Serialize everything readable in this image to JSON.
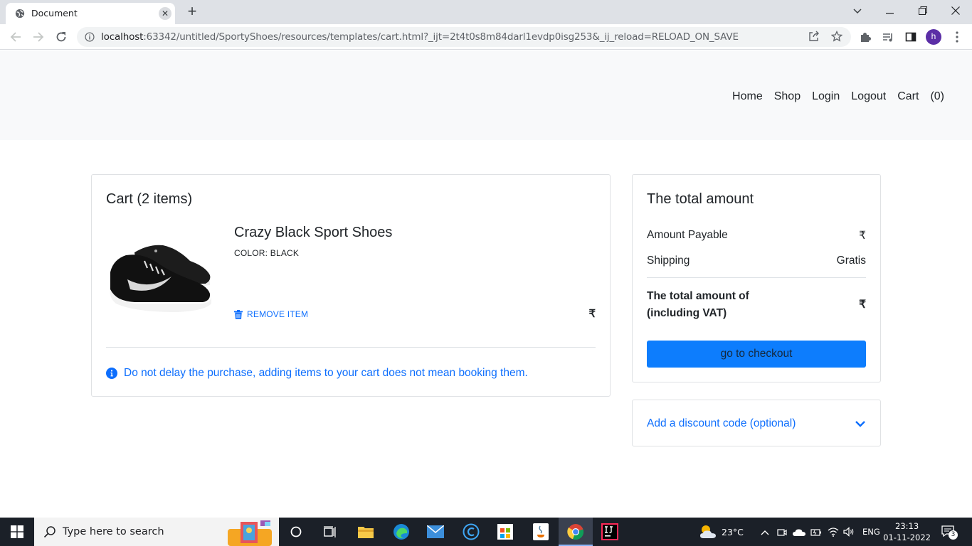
{
  "browser": {
    "tab_title": "Document",
    "tab_close": "✕",
    "new_tab": "+",
    "url_host": "localhost",
    "url_rest": ":63342/untitled/SportyShoes/resources/templates/cart.html?_ijt=2t4t0s8m84darl1evdp0isg253&_ij_reload=RELOAD_ON_SAVE",
    "profile_initial": "h"
  },
  "nav": {
    "links": [
      "Home",
      "Shop",
      "Login",
      "Logout",
      "Cart",
      "(0)"
    ]
  },
  "cart": {
    "title": "Cart (2 items)",
    "item": {
      "name": "Crazy Black Sport Shoes",
      "color": "COLOR: BLACK",
      "remove_label": "REMOVE ITEM",
      "price": "₹"
    },
    "info_message": "Do not delay the purchase, adding items to your cart does not mean booking them."
  },
  "summary": {
    "title": "The total amount",
    "amount_payable_label": "Amount Payable",
    "amount_payable_value": "₹",
    "shipping_label": "Shipping",
    "shipping_value": "Gratis",
    "total_label": "The total amount of (including VAT)",
    "total_value": "₹",
    "checkout_label": "go to checkout"
  },
  "discount": {
    "label": "Add a discount code (optional)"
  },
  "taskbar": {
    "search_placeholder": "Type here to search",
    "weather": "23°C",
    "language": "ENG",
    "time": "23:13",
    "date": "01-11-2022",
    "notification_count": "3"
  },
  "colors": {
    "primary": "#0d6efd",
    "checkout_button": "#0d7dfd",
    "header_bg": "#f8f9fa",
    "taskbar_bg": "#1b2028"
  }
}
